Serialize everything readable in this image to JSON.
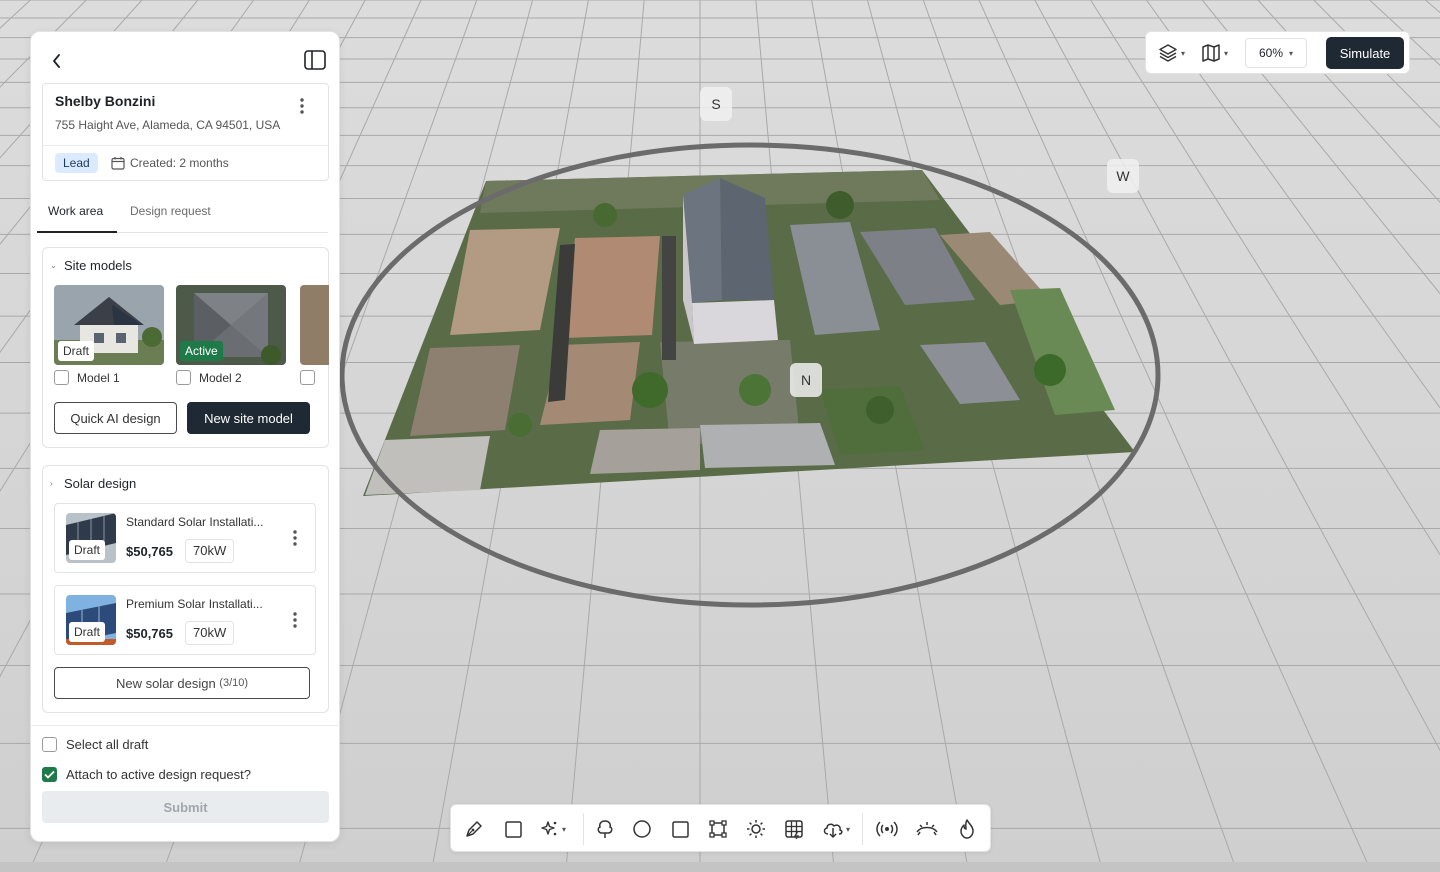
{
  "customer": {
    "name": "Shelby Bonzini",
    "address": "755 Haight Ave, Alameda, CA 94501, USA",
    "status": "Lead",
    "created": "Created: 2 months"
  },
  "tabs": [
    {
      "label": "Work area",
      "active": true
    },
    {
      "label": "Design request",
      "active": false
    }
  ],
  "site_models": {
    "title": "Site models",
    "items": [
      {
        "badge": "Draft",
        "label": "Model 1",
        "checked": false
      },
      {
        "badge": "Active",
        "label": "Model 2",
        "checked": false
      }
    ],
    "quick_ai_label": "Quick AI design",
    "new_model_label": "New site model"
  },
  "solar_design": {
    "title": "Solar design",
    "items": [
      {
        "name": "Standard Solar Installati...",
        "badge": "Draft",
        "price": "$50,765",
        "kw": "70kW"
      },
      {
        "name": "Premium Solar Installati...",
        "badge": "Draft",
        "price": "$50,765",
        "kw": "70kW"
      }
    ],
    "new_label": "New solar design",
    "new_count": "(3/10)"
  },
  "footer": {
    "select_all": "Select all draft",
    "attach": "Attach to active design request?",
    "attach_checked": true,
    "submit": "Submit"
  },
  "topbar": {
    "zoom": "60%",
    "simulate": "Simulate",
    "icons": [
      "layers-icon",
      "map-icon"
    ]
  },
  "compass": {
    "south": "S",
    "west": "W",
    "north": "N"
  },
  "bottom_tools": [
    "pen-icon",
    "rectangle-icon",
    "sparkle-icon",
    "tree-icon",
    "circle-icon",
    "square-icon",
    "transform-icon",
    "sun-icon",
    "grid-icon",
    "cloud-download-icon",
    "signal-icon",
    "horizon-icon",
    "fire-icon"
  ],
  "colors": {
    "accent_dark": "#1f2933",
    "active_green": "#1f7a4a",
    "lead_badge_bg": "#dbeafe"
  }
}
